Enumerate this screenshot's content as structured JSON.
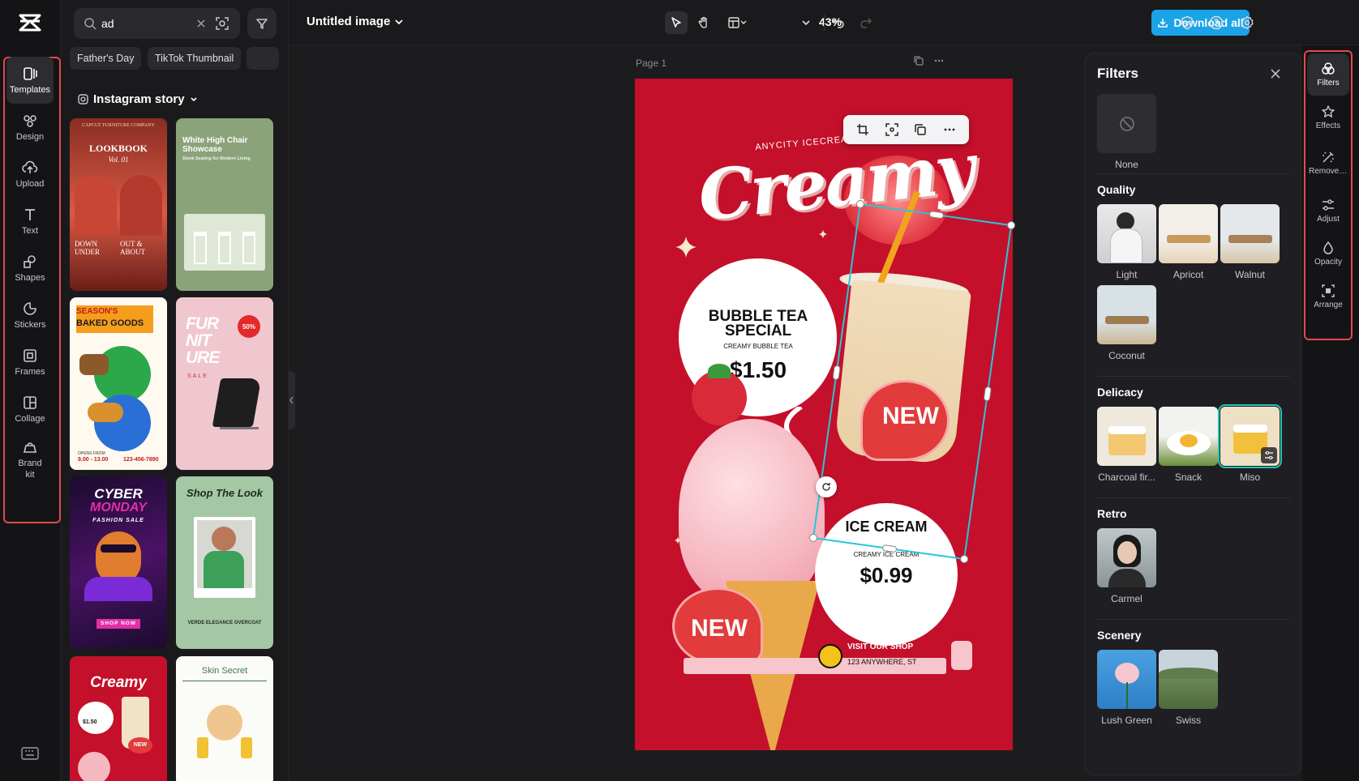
{
  "rail": {
    "items": [
      {
        "label": "Templates",
        "icon": "templates-icon"
      },
      {
        "label": "Design",
        "icon": "design-icon"
      },
      {
        "label": "Upload",
        "icon": "upload-icon"
      },
      {
        "label": "Text",
        "icon": "text-icon"
      },
      {
        "label": "Shapes",
        "icon": "shapes-icon"
      },
      {
        "label": "Stickers",
        "icon": "stickers-icon"
      },
      {
        "label": "Frames",
        "icon": "frames-icon"
      },
      {
        "label": "Collage",
        "icon": "collage-icon"
      },
      {
        "label": "Brand kit",
        "icon": "brand-kit-icon"
      }
    ]
  },
  "panel": {
    "search_value": "ad",
    "chips": [
      "Father's Day",
      "TikTok Thumbnail"
    ],
    "section_title": "Instagram story",
    "thumbs": {
      "t1_brand": "CAPCUT FURNITURE COMPANY",
      "t1_title": "LOOKBOOK",
      "t1_vol": "Vol. 01",
      "t1_left": "DOWN UNDER",
      "t1_right": "OUT & ABOUT",
      "t2_title": "White High Chair Showcase",
      "t2_sub": "Sleek Seating for Modern Living",
      "t3_title1": "SEASON'S",
      "t3_title2": "BAKED GOODS",
      "t3_open": "OPENS FROM",
      "t3_hours": "9.00 - 13.00",
      "t3_phone": "123-456-7890",
      "t4_title": "FUR NIT URE",
      "t4_sale": "SALE",
      "t4_badge": "50%",
      "t5_title1": "CYBER",
      "t5_title2": "MONDAY",
      "t5_sub": "FASHION SALE",
      "t5_cta": "SHOP NOW",
      "t6_title": "Shop The Look",
      "t6_sub": "VERDE ELEGANCE OVERCOAT",
      "t7_title": "Creamy",
      "t7_price": "$1.50",
      "t7_new": "NEW",
      "t8_title": "Skin Secret"
    }
  },
  "topbar": {
    "title": "Untitled image",
    "zoom": "43%",
    "download_label": "Download all"
  },
  "canvas": {
    "page_label": "Page 1",
    "poster": {
      "arc_text": "ANYCITY ICECREAM SHOP",
      "headline": "Creamy",
      "bubble_title": "BUBBLE TEA SPECIAL",
      "bubble_sub": "CREAMY BUBBLE TEA",
      "bubble_price": "$1.50",
      "new_label": "NEW",
      "ice_title": "ICE CREAM",
      "ice_sub": "CREAMY ICE CREAM",
      "ice_price": "$0.99",
      "visit_label": "VISIT OUR SHOP",
      "address": "123 ANYWHERE, ST"
    }
  },
  "filters": {
    "title": "Filters",
    "none_label": "None",
    "groups": {
      "quality": "Quality",
      "delicacy": "Delicacy",
      "retro": "Retro",
      "scenery": "Scenery"
    },
    "quality_items": [
      "Light",
      "Apricot",
      "Walnut",
      "Coconut"
    ],
    "delicacy_items": [
      "Charcoal fir...",
      "Snack",
      "Miso"
    ],
    "retro_items": [
      "Carmel"
    ],
    "scenery_items": [
      "Lush Green",
      "Swiss"
    ],
    "selected": "Miso"
  },
  "rrail": {
    "items": [
      {
        "label": "Filters",
        "icon": "filters-icon"
      },
      {
        "label": "Effects",
        "icon": "effects-icon"
      },
      {
        "label": "Remove backgr...",
        "icon": "remove-background-icon"
      },
      {
        "label": "Adjust",
        "icon": "adjust-icon"
      },
      {
        "label": "Opacity",
        "icon": "opacity-icon"
      },
      {
        "label": "Arrange",
        "icon": "arrange-icon"
      }
    ]
  },
  "colors": {
    "accent": "#1aa3e8",
    "poster_red": "#c4102a",
    "highlight": "#e5484d",
    "selection": "#26c6da"
  }
}
